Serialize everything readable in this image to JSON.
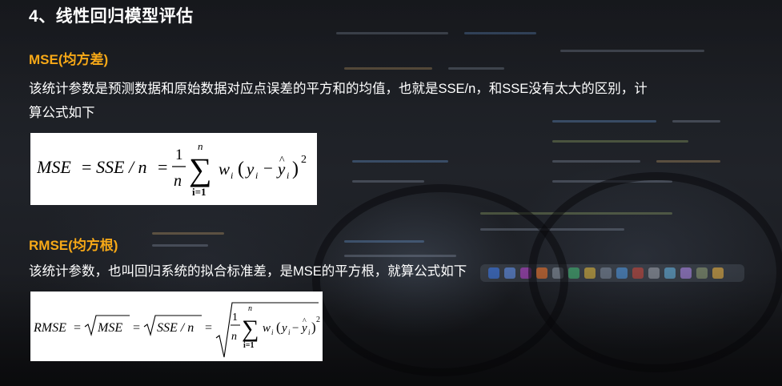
{
  "section": {
    "title": "4、线性回归模型评估"
  },
  "mse": {
    "heading": "MSE(均方差)",
    "description_line1": "该统计参数是预测数据和原始数据对应点误差的平方和的均值，也就是SSE/n，和SSE没有太大的区别，计",
    "description_line2": "算公式如下",
    "formula": {
      "lhs": "MSE",
      "mid": "SSE / n",
      "frac_num": "1",
      "frac_den": "n",
      "sum_top": "n",
      "sum_bottom": "i=1",
      "term_w": "w",
      "term_sub": "i",
      "term_y": "y",
      "exponent": "2"
    }
  },
  "rmse": {
    "heading": "RMSE(均方根)",
    "description": "该统计参数，也叫回归系统的拟合标准差，是MSE的平方根，就算公式如下",
    "formula": {
      "lhs": "RMSE",
      "sqrt1": "MSE",
      "sqrt2": "SSE / n",
      "frac_num": "1",
      "frac_den": "n",
      "sum_top": "n",
      "sum_bottom": "i=1",
      "exponent": "2"
    }
  },
  "colors": {
    "heading_accent": "#f6a817",
    "text": "#ffffff",
    "background": "#1b1d22"
  }
}
